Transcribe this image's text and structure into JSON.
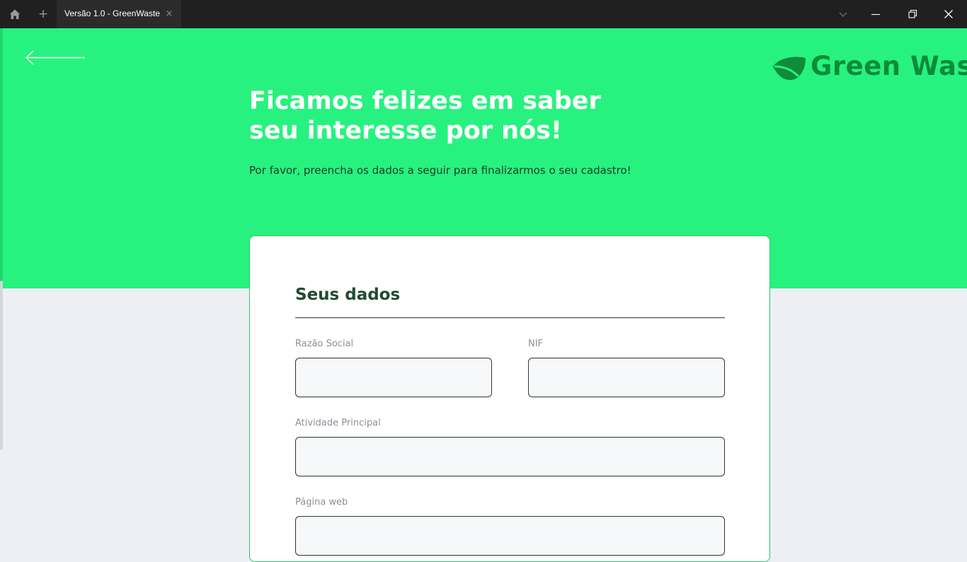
{
  "window": {
    "tab_title": "Versão 1.0 - GreenWaste",
    "tab_close": "×",
    "new_tab": "+",
    "icons": [
      "home-icon",
      "plus-icon",
      "close-icon",
      "chevron-down-icon",
      "minimize-icon",
      "maximize-icon",
      "window-close-icon"
    ]
  },
  "header": {
    "logo_text": "Green Waste",
    "title_line1": "Ficamos felizes em saber",
    "title_line2": "seu interesse por nós!",
    "subtitle": "Por favor, preencha os dados a seguir para finalizarmos o seu cadastro!"
  },
  "form": {
    "section_title": "Seus dados",
    "fields": {
      "razao_social": {
        "label": "Razão Social",
        "value": ""
      },
      "nif": {
        "label": "NIF",
        "value": ""
      },
      "atividade": {
        "label": "Atividade Principal",
        "value": ""
      },
      "pagina_web": {
        "label": "Página web",
        "value": ""
      }
    }
  },
  "colors": {
    "brand_green": "#27f27f",
    "logo_green": "#0f8b3a",
    "heading_dark_green": "#214a33",
    "page_background": "#eeeff4",
    "titlebar": "#202020"
  }
}
